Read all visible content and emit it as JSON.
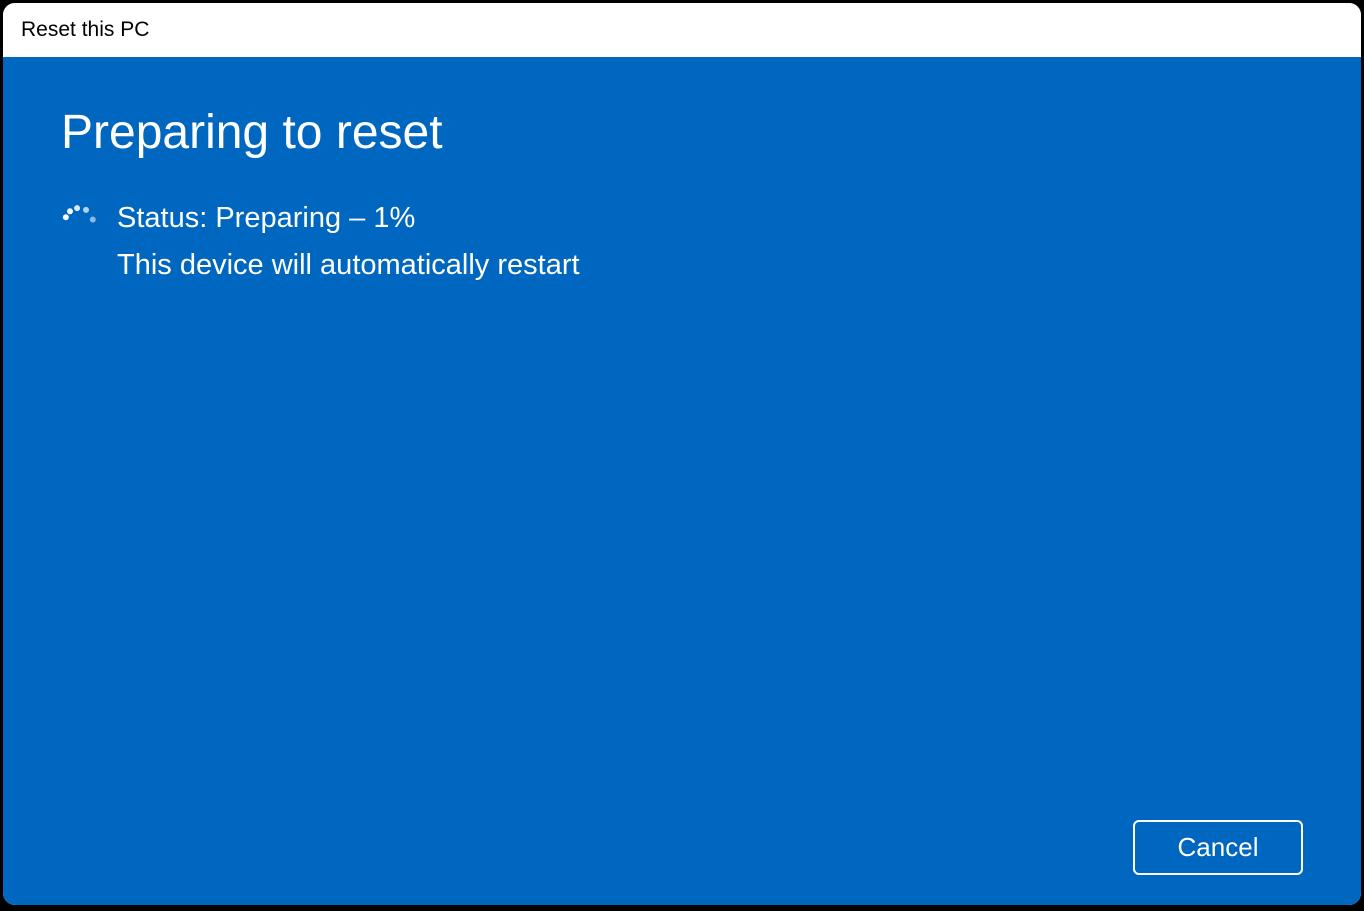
{
  "window": {
    "title": "Reset this PC"
  },
  "main": {
    "heading": "Preparing to reset",
    "status_line": "Status: Preparing – 1%",
    "restart_notice": "This device will automatically restart"
  },
  "footer": {
    "cancel_label": "Cancel"
  },
  "colors": {
    "accent": "#0067c0"
  }
}
